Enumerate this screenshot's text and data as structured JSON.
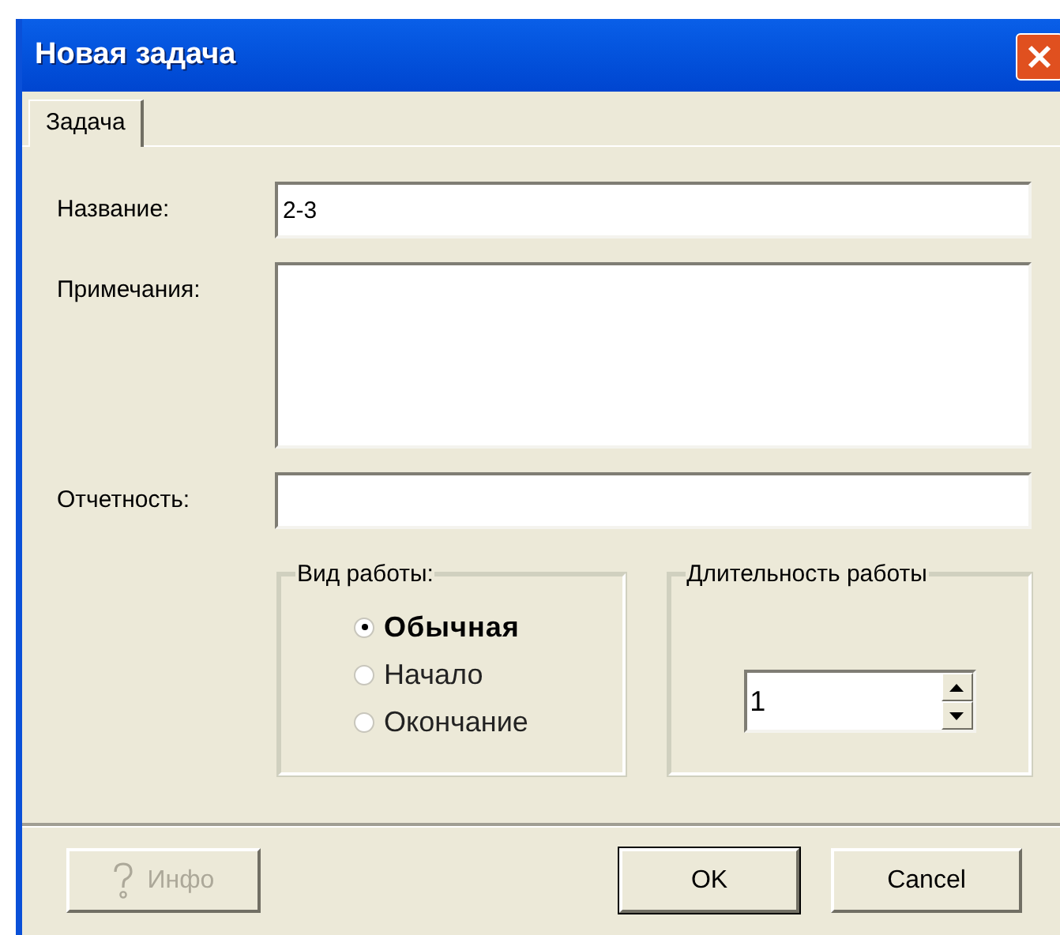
{
  "window": {
    "title": "Новая задача"
  },
  "tabs": [
    {
      "label": "Задача",
      "selected": true
    }
  ],
  "fields": [
    {
      "label": "Название:",
      "value": "2-3",
      "kind": "line"
    },
    {
      "label": "Примечания:",
      "kind": "multiline"
    },
    {
      "label": "Отчетность:",
      "kind": "line"
    }
  ],
  "work_type": {
    "title": "Вид работы:",
    "options": [
      {
        "label": "Обычная",
        "selected": true
      },
      {
        "label": "Начало",
        "selected": false
      },
      {
        "label": "Окончание",
        "selected": false
      }
    ]
  },
  "duration": {
    "title": "Длительность работы",
    "value": "1"
  },
  "buttons": [
    {
      "label": "Инфо",
      "kind": "help",
      "disabled": true
    },
    {
      "label": "OK",
      "kind": "default",
      "disabled": false
    },
    {
      "label": "Cancel",
      "kind": "normal",
      "disabled": false
    }
  ]
}
